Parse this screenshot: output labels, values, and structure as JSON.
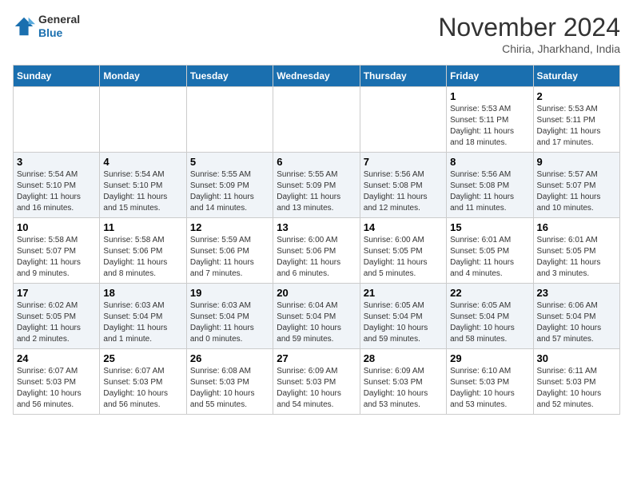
{
  "header": {
    "logo_line1": "General",
    "logo_line2": "Blue",
    "month": "November 2024",
    "location": "Chiria, Jharkhand, India"
  },
  "weekdays": [
    "Sunday",
    "Monday",
    "Tuesday",
    "Wednesday",
    "Thursday",
    "Friday",
    "Saturday"
  ],
  "weeks": [
    [
      {
        "day": "",
        "info": ""
      },
      {
        "day": "",
        "info": ""
      },
      {
        "day": "",
        "info": ""
      },
      {
        "day": "",
        "info": ""
      },
      {
        "day": "",
        "info": ""
      },
      {
        "day": "1",
        "info": "Sunrise: 5:53 AM\nSunset: 5:11 PM\nDaylight: 11 hours\nand 18 minutes."
      },
      {
        "day": "2",
        "info": "Sunrise: 5:53 AM\nSunset: 5:11 PM\nDaylight: 11 hours\nand 17 minutes."
      }
    ],
    [
      {
        "day": "3",
        "info": "Sunrise: 5:54 AM\nSunset: 5:10 PM\nDaylight: 11 hours\nand 16 minutes."
      },
      {
        "day": "4",
        "info": "Sunrise: 5:54 AM\nSunset: 5:10 PM\nDaylight: 11 hours\nand 15 minutes."
      },
      {
        "day": "5",
        "info": "Sunrise: 5:55 AM\nSunset: 5:09 PM\nDaylight: 11 hours\nand 14 minutes."
      },
      {
        "day": "6",
        "info": "Sunrise: 5:55 AM\nSunset: 5:09 PM\nDaylight: 11 hours\nand 13 minutes."
      },
      {
        "day": "7",
        "info": "Sunrise: 5:56 AM\nSunset: 5:08 PM\nDaylight: 11 hours\nand 12 minutes."
      },
      {
        "day": "8",
        "info": "Sunrise: 5:56 AM\nSunset: 5:08 PM\nDaylight: 11 hours\nand 11 minutes."
      },
      {
        "day": "9",
        "info": "Sunrise: 5:57 AM\nSunset: 5:07 PM\nDaylight: 11 hours\nand 10 minutes."
      }
    ],
    [
      {
        "day": "10",
        "info": "Sunrise: 5:58 AM\nSunset: 5:07 PM\nDaylight: 11 hours\nand 9 minutes."
      },
      {
        "day": "11",
        "info": "Sunrise: 5:58 AM\nSunset: 5:06 PM\nDaylight: 11 hours\nand 8 minutes."
      },
      {
        "day": "12",
        "info": "Sunrise: 5:59 AM\nSunset: 5:06 PM\nDaylight: 11 hours\nand 7 minutes."
      },
      {
        "day": "13",
        "info": "Sunrise: 6:00 AM\nSunset: 5:06 PM\nDaylight: 11 hours\nand 6 minutes."
      },
      {
        "day": "14",
        "info": "Sunrise: 6:00 AM\nSunset: 5:05 PM\nDaylight: 11 hours\nand 5 minutes."
      },
      {
        "day": "15",
        "info": "Sunrise: 6:01 AM\nSunset: 5:05 PM\nDaylight: 11 hours\nand 4 minutes."
      },
      {
        "day": "16",
        "info": "Sunrise: 6:01 AM\nSunset: 5:05 PM\nDaylight: 11 hours\nand 3 minutes."
      }
    ],
    [
      {
        "day": "17",
        "info": "Sunrise: 6:02 AM\nSunset: 5:05 PM\nDaylight: 11 hours\nand 2 minutes."
      },
      {
        "day": "18",
        "info": "Sunrise: 6:03 AM\nSunset: 5:04 PM\nDaylight: 11 hours\nand 1 minute."
      },
      {
        "day": "19",
        "info": "Sunrise: 6:03 AM\nSunset: 5:04 PM\nDaylight: 11 hours\nand 0 minutes."
      },
      {
        "day": "20",
        "info": "Sunrise: 6:04 AM\nSunset: 5:04 PM\nDaylight: 10 hours\nand 59 minutes."
      },
      {
        "day": "21",
        "info": "Sunrise: 6:05 AM\nSunset: 5:04 PM\nDaylight: 10 hours\nand 59 minutes."
      },
      {
        "day": "22",
        "info": "Sunrise: 6:05 AM\nSunset: 5:04 PM\nDaylight: 10 hours\nand 58 minutes."
      },
      {
        "day": "23",
        "info": "Sunrise: 6:06 AM\nSunset: 5:04 PM\nDaylight: 10 hours\nand 57 minutes."
      }
    ],
    [
      {
        "day": "24",
        "info": "Sunrise: 6:07 AM\nSunset: 5:03 PM\nDaylight: 10 hours\nand 56 minutes."
      },
      {
        "day": "25",
        "info": "Sunrise: 6:07 AM\nSunset: 5:03 PM\nDaylight: 10 hours\nand 56 minutes."
      },
      {
        "day": "26",
        "info": "Sunrise: 6:08 AM\nSunset: 5:03 PM\nDaylight: 10 hours\nand 55 minutes."
      },
      {
        "day": "27",
        "info": "Sunrise: 6:09 AM\nSunset: 5:03 PM\nDaylight: 10 hours\nand 54 minutes."
      },
      {
        "day": "28",
        "info": "Sunrise: 6:09 AM\nSunset: 5:03 PM\nDaylight: 10 hours\nand 53 minutes."
      },
      {
        "day": "29",
        "info": "Sunrise: 6:10 AM\nSunset: 5:03 PM\nDaylight: 10 hours\nand 53 minutes."
      },
      {
        "day": "30",
        "info": "Sunrise: 6:11 AM\nSunset: 5:03 PM\nDaylight: 10 hours\nand 52 minutes."
      }
    ]
  ]
}
